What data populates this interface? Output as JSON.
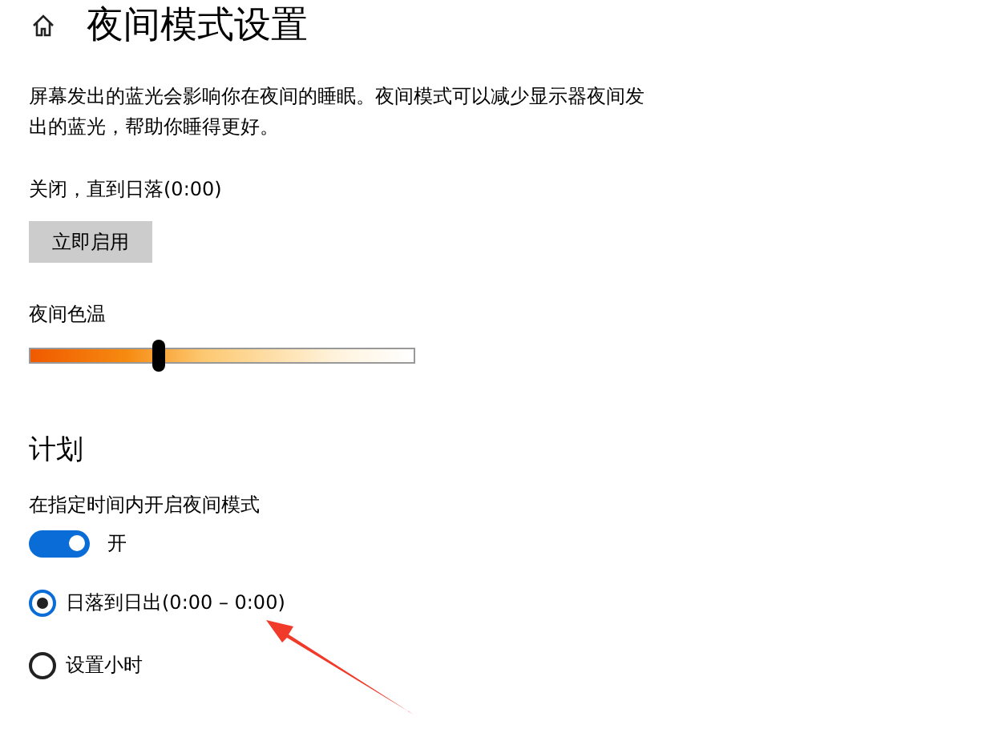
{
  "title": "夜间模式设置",
  "description": "屏幕发出的蓝光会影响你在夜间的睡眠。夜间模式可以减少显示器夜间发出的蓝光，帮助你睡得更好。",
  "status": "关闭，直到日落(0:00)",
  "enable_button": "立即启用",
  "temperature": {
    "label": "夜间色温",
    "level": 0.34
  },
  "schedule": {
    "heading": "计划",
    "toggle_label": "在指定时间内开启夜间模式",
    "toggle": {
      "on": true,
      "text": "开"
    },
    "options": [
      {
        "label": "日落到日出(0:00 – 0:00)",
        "selected": true
      },
      {
        "label": "设置小时",
        "selected": false
      }
    ]
  }
}
